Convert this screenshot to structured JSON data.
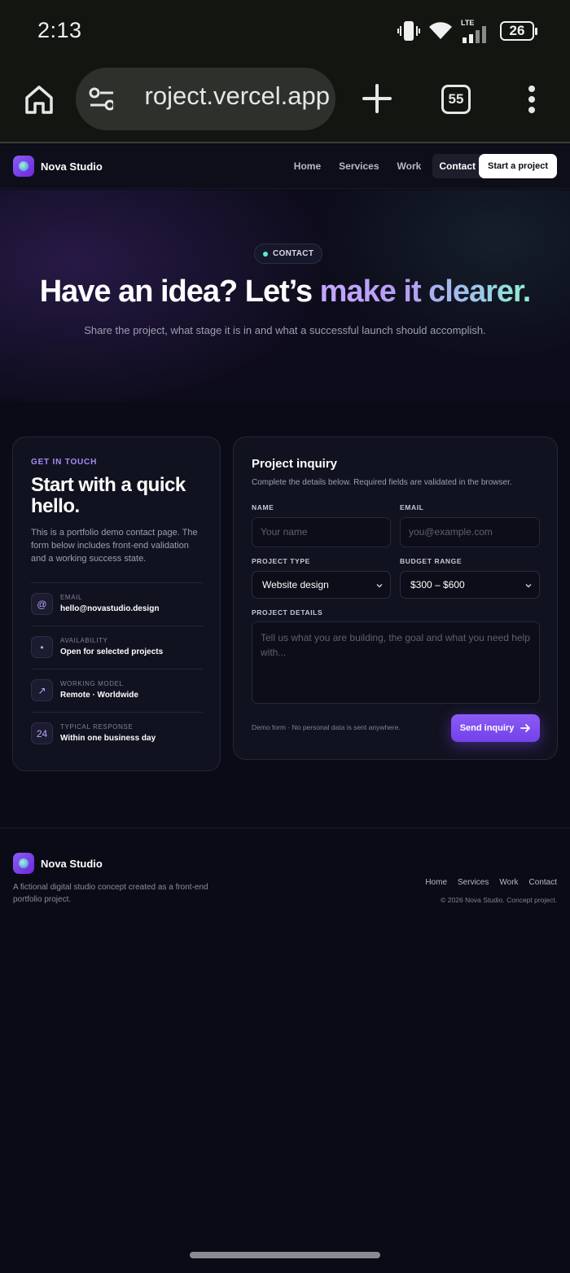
{
  "status_bar": {
    "time": "2:13",
    "network": "LTE",
    "battery": "26",
    "icons": [
      "vibrate-icon",
      "wifi-icon",
      "signal-icon",
      "battery-icon"
    ]
  },
  "browser": {
    "url": "roject.vercel.app",
    "tab_count": "55",
    "icons": [
      "home-icon",
      "tune-icon",
      "plus-icon",
      "more-icon"
    ]
  },
  "nav": {
    "brand": "Nova Studio",
    "links": [
      "Home",
      "Services",
      "Work",
      "Contact"
    ],
    "active_link": "Contact",
    "cta": "Start a project"
  },
  "hero": {
    "pill": "CONTACT",
    "title_plain": "Have an idea? Let’s ",
    "title_gradient": "make it clearer.",
    "subtitle": "Share the project, what stage it is in and what a successful launch should accomplish."
  },
  "contact_card": {
    "eyebrow": "GET IN TOUCH",
    "title": "Start with a quick hello.",
    "description": "This is a portfolio demo contact page. The form below includes front-end validation and a working success state.",
    "items": [
      {
        "icon": "@",
        "label": "EMAIL",
        "value": "hello@novastudio.design"
      },
      {
        "icon": "•",
        "label": "AVAILABILITY",
        "value": "Open for selected projects"
      },
      {
        "icon": "↗",
        "label": "WORKING MODEL",
        "value": "Remote · Worldwide"
      },
      {
        "icon": "24",
        "label": "TYPICAL RESPONSE",
        "value": "Within one business day"
      }
    ]
  },
  "form": {
    "title": "Project inquiry",
    "subtitle": "Complete the details below. Required fields are validated in the browser.",
    "name_label": "NAME",
    "name_placeholder": "Your name",
    "email_label": "EMAIL",
    "email_placeholder": "you@example.com",
    "project_type_label": "PROJECT TYPE",
    "project_type_value": "Website design",
    "budget_label": "BUDGET RANGE",
    "budget_value": "$300 – $600",
    "details_label": "PROJECT DETAILS",
    "details_placeholder": "Tell us what you are building, the goal and what you need help with...",
    "disclaimer": "Demo form · No personal data is sent anywhere.",
    "submit": "Send inquiry"
  },
  "footer": {
    "brand": "Nova Studio",
    "description": "A fictional digital studio concept created as a front-end portfolio project.",
    "links": [
      "Home",
      "Services",
      "Work",
      "Contact"
    ],
    "copyright": "© 2026 Nova Studio. Concept project."
  },
  "colors": {
    "background": "#0a0b16",
    "accent": "#8b5cf6",
    "teal": "#5eead4"
  }
}
